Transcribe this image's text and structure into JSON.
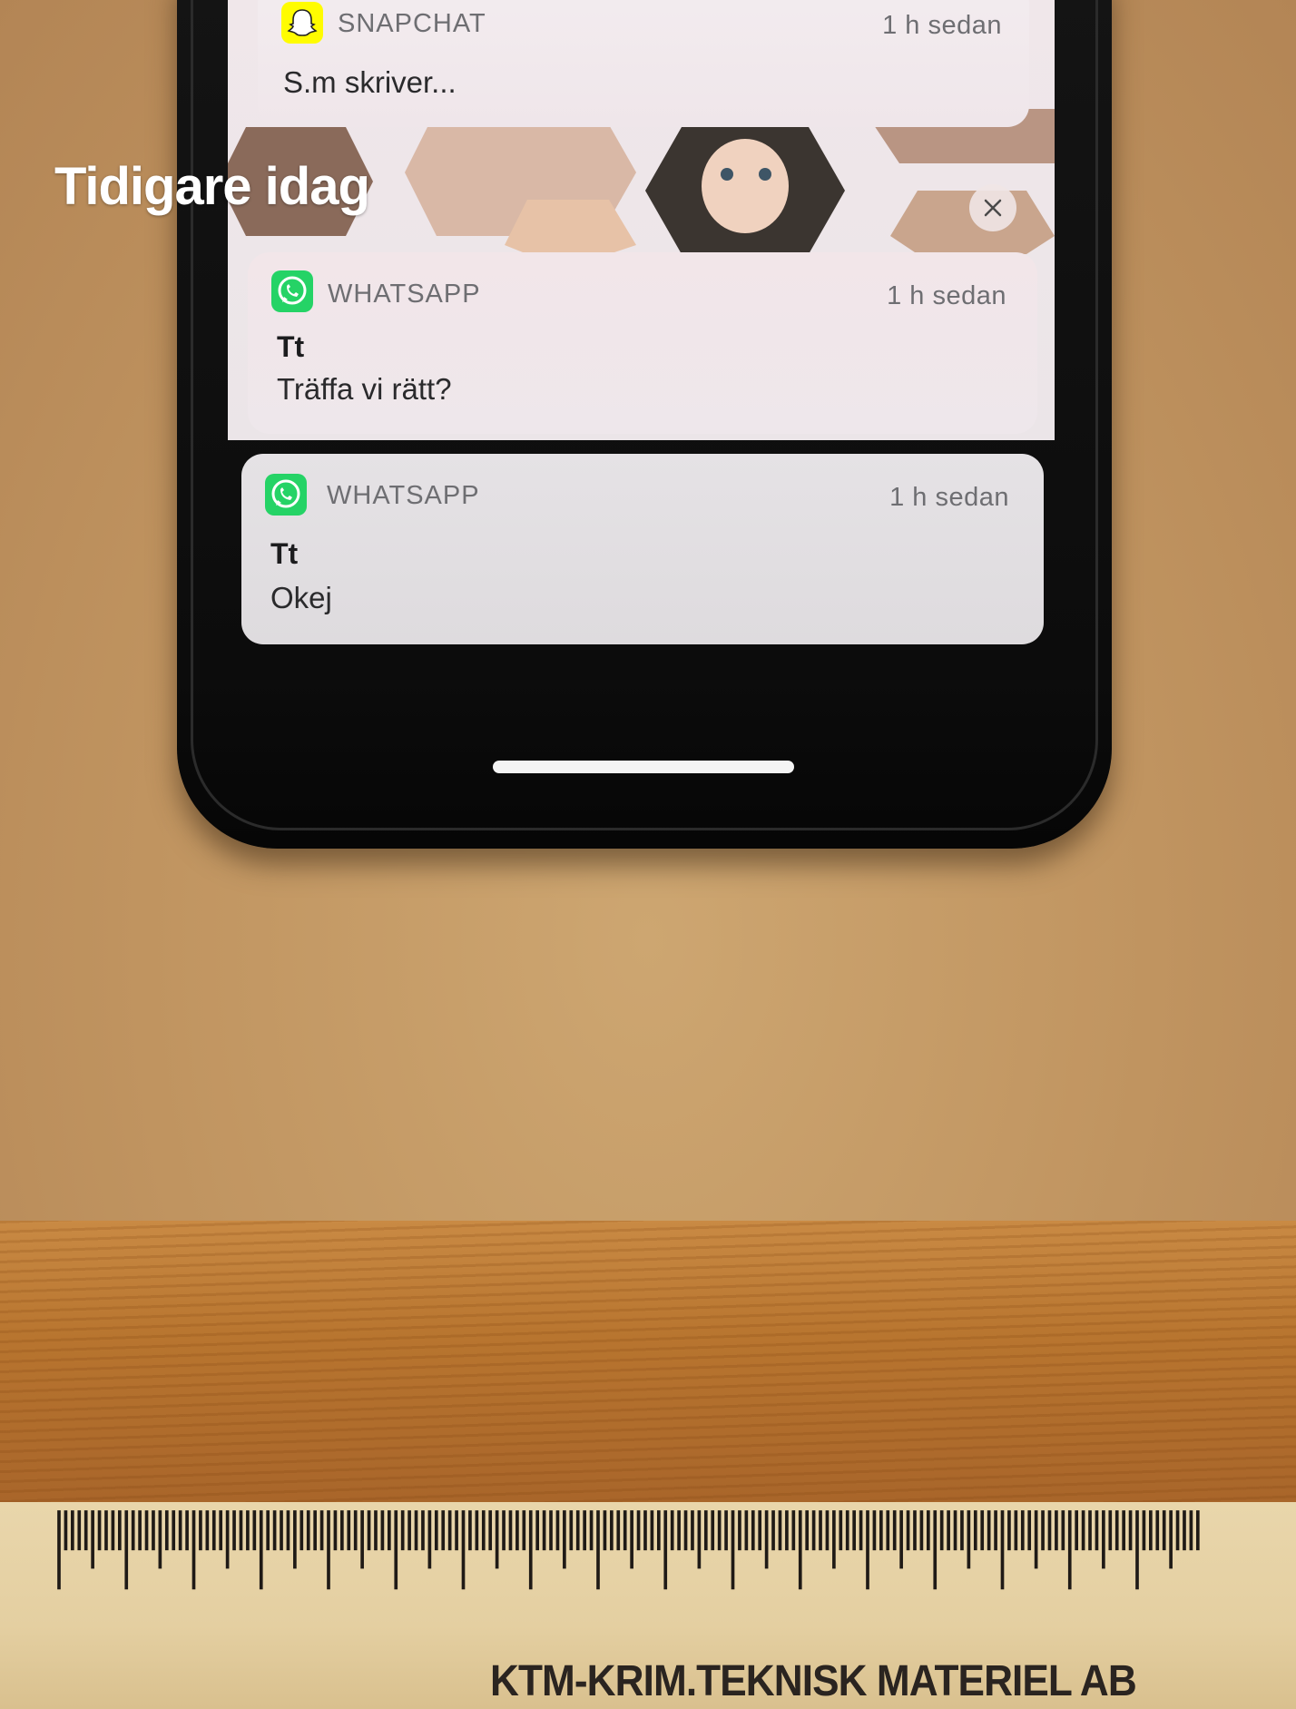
{
  "notifications": [
    {
      "app": "SNAPCHAT",
      "time": "1 h sedan",
      "body": "S.m skriver..."
    },
    {
      "app": "WHATSAPP",
      "time": "1 h sedan",
      "sender": "Tt",
      "body": "Träffa vi rätt?"
    },
    {
      "app": "WHATSAPP",
      "time": "1 h sedan",
      "sender": "Tt",
      "body": "Okej"
    }
  ],
  "section_title": "Tidigare idag",
  "icons": {
    "snapchat": "snapchat-ghost-icon",
    "whatsapp": "whatsapp-phone-icon",
    "clear": "close-icon"
  },
  "colors": {
    "snapchat_yellow": "#FFFC00",
    "whatsapp_green": "#25D366"
  },
  "ruler_brand": "KTM-KRIM.TEKNISK MATERIEL AB"
}
